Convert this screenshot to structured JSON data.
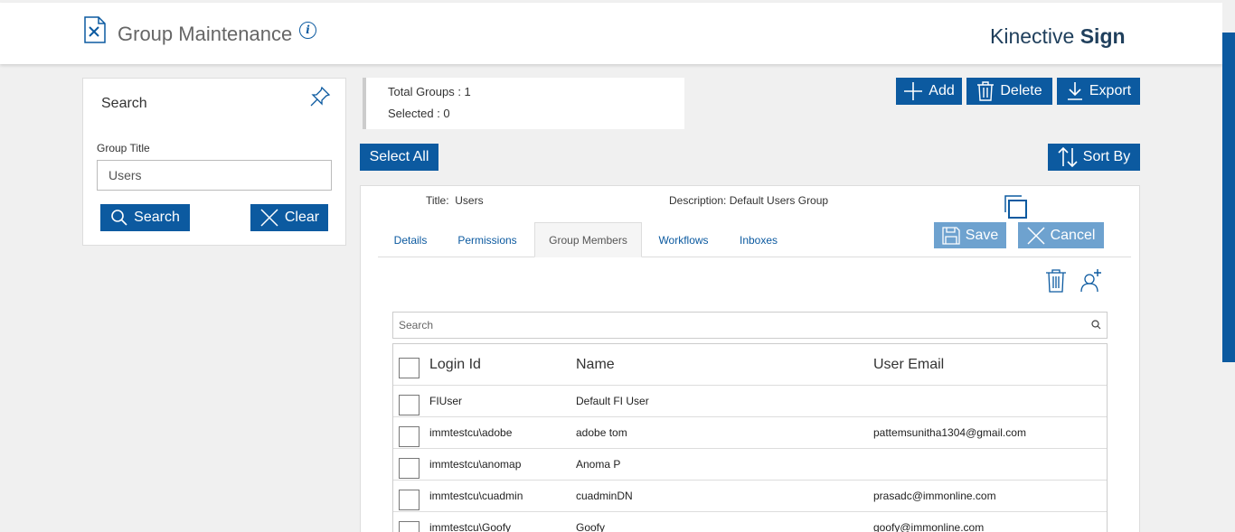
{
  "header": {
    "app_title": "Group Maintenance",
    "info_glyph": "i",
    "brand_prefix": "Kinective",
    "brand_suffix": "Sign"
  },
  "search_panel": {
    "heading": "Search",
    "group_title_label": "Group Title",
    "group_title_value": "Users",
    "search_button": "Search",
    "clear_button": "Clear"
  },
  "stats": {
    "total_groups": "Total Groups : 1",
    "selected": "Selected : 0"
  },
  "toolbar": {
    "add": "Add",
    "delete": "Delete",
    "export": "Export",
    "select_all": "Select All",
    "sort_by": "Sort By"
  },
  "detail": {
    "title_label": "Title:",
    "title_value": "Users",
    "description_label": "Description:",
    "description_value": "Default Users Group",
    "save": "Save",
    "cancel": "Cancel",
    "tabs": [
      "Details",
      "Permissions",
      "Group Members",
      "Workflows",
      "Inboxes"
    ],
    "active_tab": "Group Members"
  },
  "members": {
    "search_placeholder": "Search",
    "columns": [
      "Login Id",
      "Name",
      "User Email"
    ],
    "rows": [
      {
        "login": "FIUser",
        "name": "Default FI User",
        "email": ""
      },
      {
        "login": "immtestcu\\adobe",
        "name": "adobe tom",
        "email": "pattemsunitha1304@gmail.com"
      },
      {
        "login": "immtestcu\\anomap",
        "name": "Anoma P",
        "email": ""
      },
      {
        "login": "immtestcu\\cuadmin",
        "name": "cuadminDN",
        "email": "prasadc@immonline.com"
      },
      {
        "login": "immtestcu\\Goofy",
        "name": "Goofy",
        "email": "goofy@immonline.com"
      }
    ]
  },
  "colors": {
    "primary": "#0c5aa0",
    "primary_disabled": "#6ea2cf",
    "background": "#f0f0f0"
  },
  "icons": [
    "document-edit-icon",
    "info-icon",
    "pin-icon",
    "search-icon",
    "close-icon",
    "plus-icon",
    "trash-icon",
    "download-icon",
    "sort-icon",
    "copy-icon",
    "save-icon",
    "add-user-icon"
  ]
}
